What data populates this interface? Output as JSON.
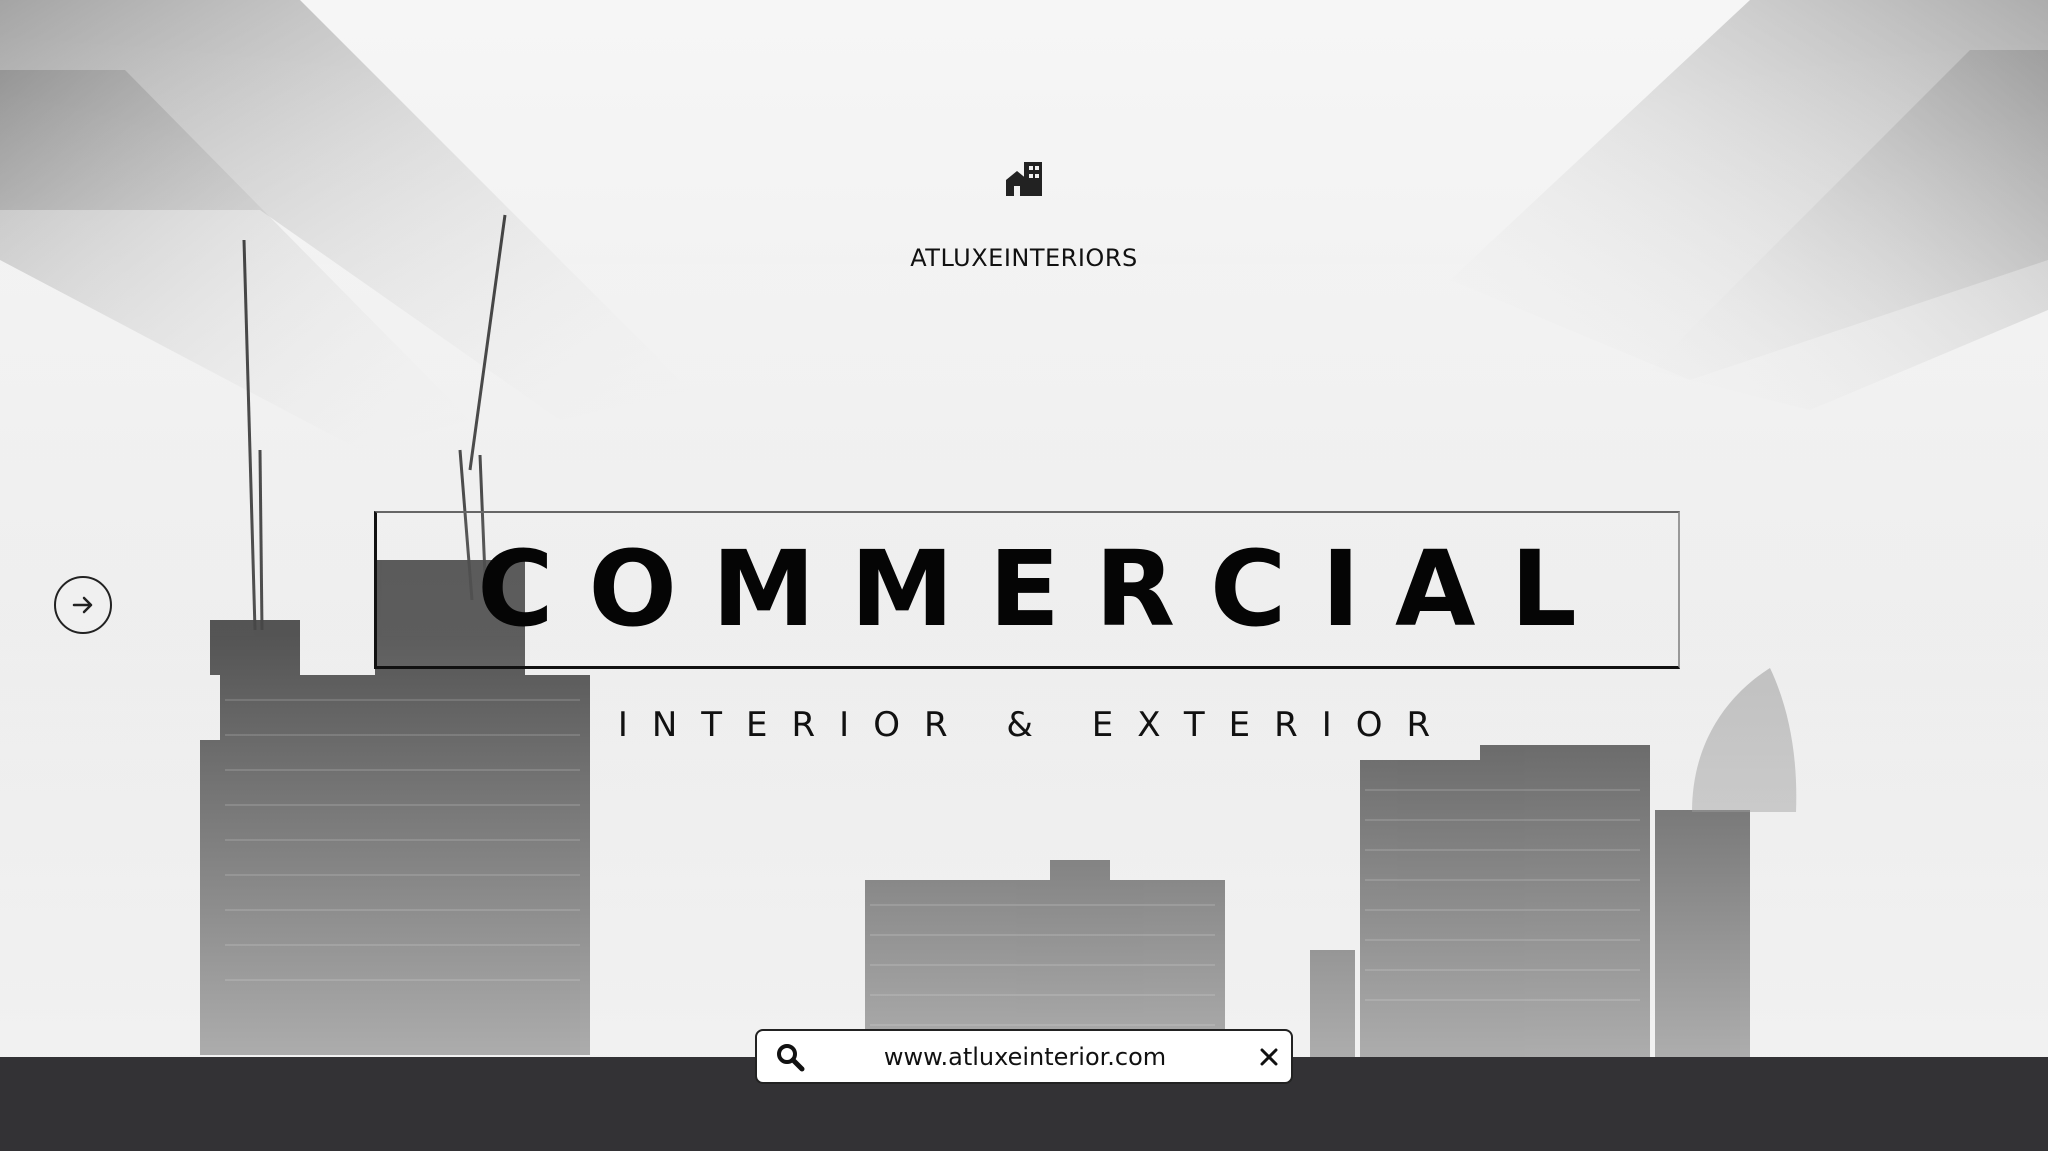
{
  "brand": {
    "name": "ATLUXEINTERIORS"
  },
  "hero": {
    "title": "COMMERCIAL",
    "subtitle": "INTERIOR & EXTERIOR"
  },
  "search": {
    "value": "www.atluxeinterior.com"
  },
  "icons": {
    "logo": "building-icon",
    "next": "arrow-right-icon",
    "search": "search-icon",
    "clear": "close-icon"
  },
  "colors": {
    "bottom_bar": "#333235",
    "text": "#111111",
    "background": "#f1f1f1"
  }
}
